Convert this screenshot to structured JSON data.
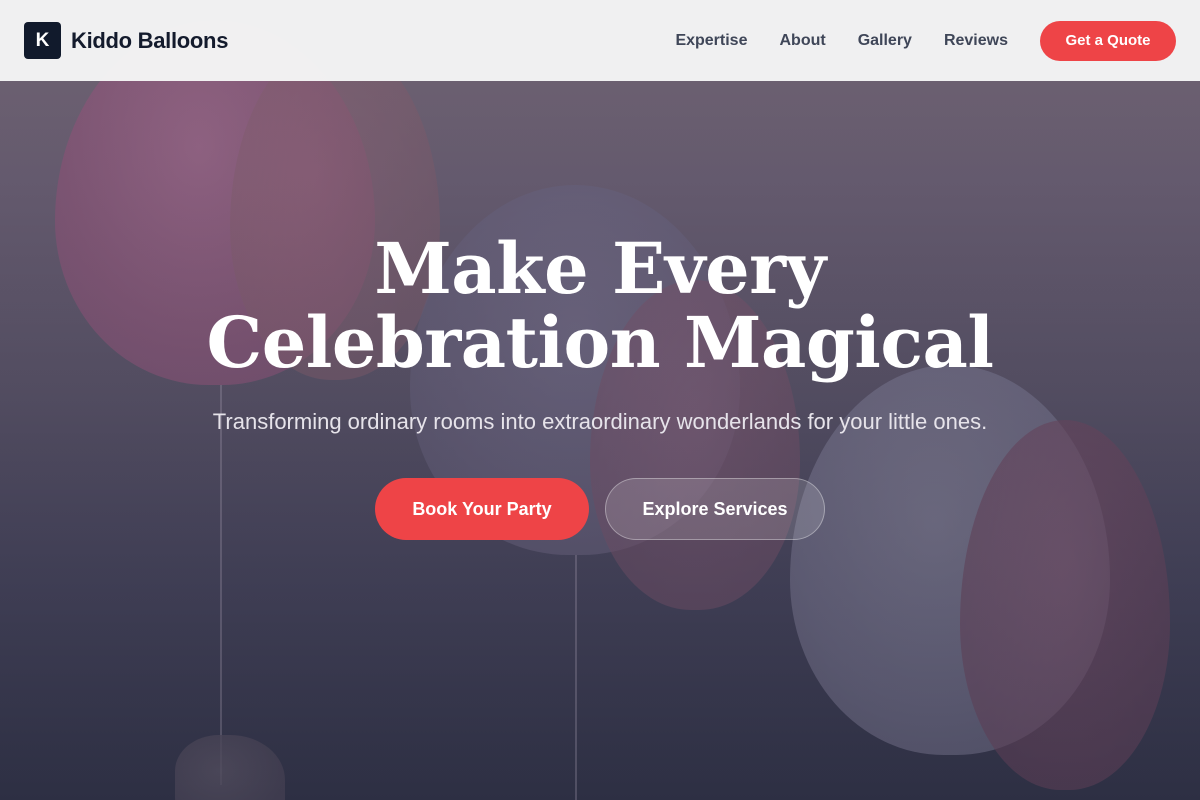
{
  "brand": {
    "mark": "K",
    "name": "Kiddo Balloons"
  },
  "nav": {
    "links": [
      "Expertise",
      "About",
      "Gallery",
      "Reviews"
    ],
    "cta_label": "Get a Quote"
  },
  "hero": {
    "title": "Make Every Celebration Magical",
    "subtitle": "Transforming ordinary rooms into extraordinary wonderlands for your little ones.",
    "primary_cta": "Book Your Party",
    "secondary_cta": "Explore Services",
    "background_image": "balloons-photo"
  },
  "colors": {
    "accent": "#ee4447",
    "brand_dark": "#111a2c",
    "nav_background": "#f3f3f4"
  }
}
